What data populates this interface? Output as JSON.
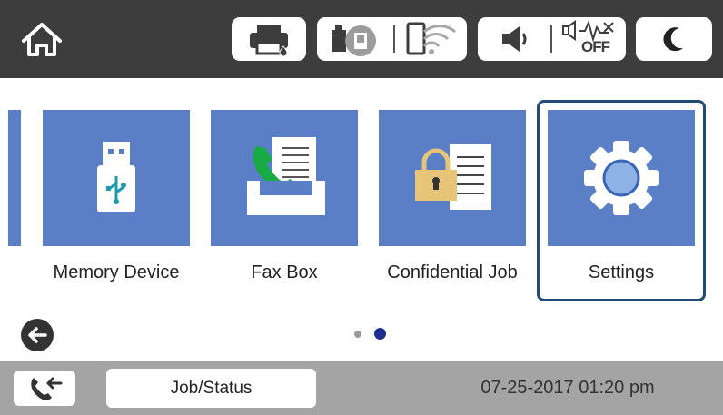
{
  "header": {
    "icons": [
      "home-icon",
      "printer-ink-icon",
      "wired-network-icon",
      "wifi-icon",
      "speaker-icon",
      "sound-off-icon",
      "sleep-moon-icon"
    ],
    "sound_off_text": "OFF"
  },
  "tiles": [
    {
      "label": "Memory Device",
      "icon": "usb-drive-icon"
    },
    {
      "label": "Fax Box",
      "icon": "fax-box-icon"
    },
    {
      "label": "Confidential Job",
      "icon": "locked-document-icon"
    },
    {
      "label": "Settings",
      "icon": "gear-icon",
      "selected": true
    }
  ],
  "pager": {
    "pages": 2,
    "current": 2
  },
  "footer": {
    "job_status_label": "Job/Status",
    "datetime": "07-25-2017 01:20 pm"
  },
  "colors": {
    "topbar": "#3d3d3d",
    "tile": "#5a7fc7",
    "focus_border": "#1f4b75",
    "bottombar": "#a4a4a4",
    "active_dot": "#1b2f8e"
  }
}
